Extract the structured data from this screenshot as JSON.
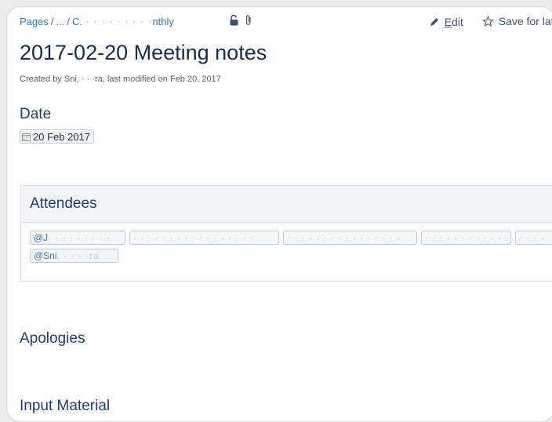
{
  "breadcrumb": {
    "root": "Pages",
    "sep": "/",
    "ellipsis": "...",
    "current_prefix": "C.",
    "current_blurred": " · · · ·   · · · · ·",
    "current_suffix": "nthly"
  },
  "actions": {
    "edit": "Edit",
    "save": "Save for later"
  },
  "page": {
    "title": "2017-02-20 Meeting notes",
    "byline": "Created by Sni,  ·  · ·ra, last modified on Feb 20, 2017"
  },
  "date_section": {
    "heading": "Date",
    "value": "20 Feb 2017"
  },
  "attendees": {
    "heading": "Attendees",
    "mentions_row1": [
      {
        "prefix": "@J",
        "blurred": " · · · · · · · · ·"
      },
      {
        "prefix": "",
        "blurred": "· · · · · · · · · · · · · · · · ·"
      },
      {
        "prefix": "",
        "blurred": "· · · · · · · · · · · · · · · ·"
      },
      {
        "prefix": "",
        "blurred": "· · · · · · · · · · · ·"
      },
      {
        "prefix": "",
        "blurred": "· · · ·"
      }
    ],
    "mentions_row2": [
      {
        "prefix": "@Sni",
        "blurred": ",  · · · ·ra"
      }
    ]
  },
  "sections": {
    "apologies": "Apologies",
    "input_material": "Input Material"
  },
  "colors": {
    "link": "#3b73af",
    "heading": "#1f3d7a",
    "text": "#172b4d"
  }
}
